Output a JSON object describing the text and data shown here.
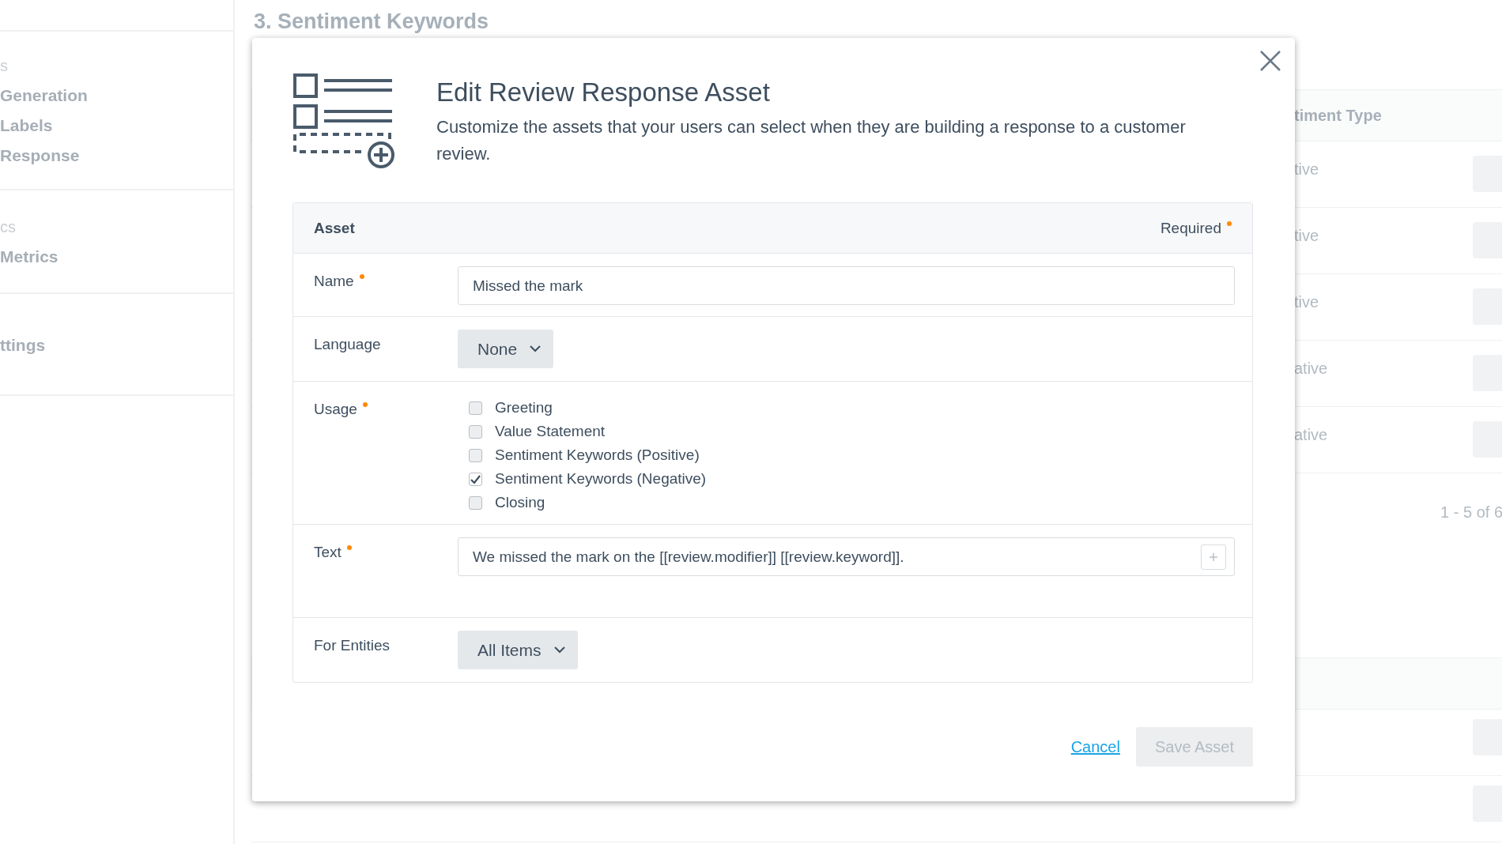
{
  "sidebar": {
    "groups": [
      {
        "header": "s",
        "items": [
          "Generation",
          "Labels",
          "Response"
        ]
      },
      {
        "header": "cs",
        "items": [
          "Metrics"
        ]
      },
      {
        "items": [
          "ttings"
        ]
      }
    ]
  },
  "page": {
    "heading": "3. Sentiment Keywords",
    "table": {
      "column": "timent Type",
      "rows": [
        "tive",
        "tive",
        "tive",
        "ative",
        "ative"
      ]
    },
    "pagination": "1 - 5 of 6"
  },
  "modal": {
    "title": "Edit Review Response Asset",
    "description": "Customize the assets that your users can select when they are building a response to a customer review.",
    "form": {
      "header": "Asset",
      "required_note": "Required",
      "fields": [
        {
          "kind": "input",
          "label": "Name",
          "required": true,
          "value": "Missed the mark"
        },
        {
          "kind": "select",
          "label": "Language",
          "required": false,
          "value": "None"
        },
        {
          "kind": "checkboxes",
          "label": "Usage",
          "required": true,
          "options": [
            {
              "label": "Greeting",
              "checked": false
            },
            {
              "label": "Value Statement",
              "checked": false
            },
            {
              "label": "Sentiment Keywords (Positive)",
              "checked": false
            },
            {
              "label": "Sentiment Keywords (Negative)",
              "checked": true
            },
            {
              "label": "Closing",
              "checked": false
            }
          ]
        },
        {
          "kind": "text",
          "label": "Text",
          "required": true,
          "value": "We missed the mark on the [[review.modifier]] [[review.keyword]]."
        },
        {
          "kind": "select",
          "label": "For Entities",
          "required": false,
          "value": "All Items"
        }
      ]
    },
    "cancel": "Cancel",
    "save": {
      "label": "Save Asset",
      "disabled": true
    }
  }
}
